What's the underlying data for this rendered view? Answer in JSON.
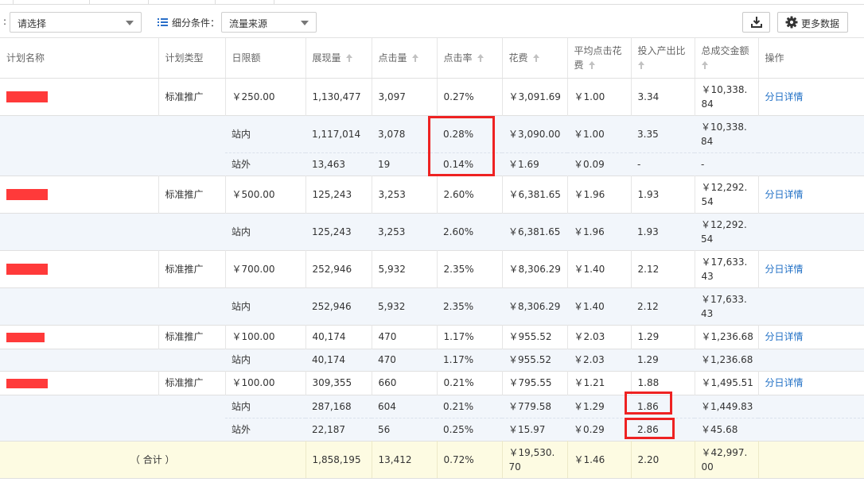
{
  "filter": {
    "colon": ":",
    "select_placeholder": "请选择",
    "segment_label": "细分条件：",
    "segment_value": "流量来源",
    "more_data_label": "更多数据"
  },
  "icons": {
    "list": "list-icon",
    "download": "download-icon",
    "settings": "gear-icon",
    "sort": "sort-up-arrow-icon",
    "dropdown": "chevron-down-icon"
  },
  "columns": {
    "plan_name": "计划名称",
    "plan_type": "计划类型",
    "daily_limit": "日限额",
    "impressions": "展现量",
    "clicks": "点击量",
    "ctr": "点击率",
    "cost": "花费",
    "avg_cpc": "平均点击花费",
    "roi": "投入产出比",
    "gmv": "总成交金额",
    "action": "操作"
  },
  "rows": {
    "p1": {
      "type": "标准推广",
      "limit": "￥250.00",
      "impr": "1,130,477",
      "clicks": "3,097",
      "ctr": "0.27%",
      "cost": "￥3,091.69",
      "cpc": "￥1.00",
      "roi": "3.34",
      "gmv": "￥10,338.84",
      "action": "分日详情"
    },
    "p1s1": {
      "source": "站内",
      "impr": "1,117,014",
      "clicks": "3,078",
      "ctr": "0.28%",
      "cost": "￥3,090.00",
      "cpc": "￥1.00",
      "roi": "3.35",
      "gmv": "￥10,338.84"
    },
    "p1s2": {
      "source": "站外",
      "impr": "13,463",
      "clicks": "19",
      "ctr": "0.14%",
      "cost": "￥1.69",
      "cpc": "￥0.09",
      "roi": "-",
      "gmv": "-"
    },
    "p2": {
      "type": "标准推广",
      "limit": "￥500.00",
      "impr": "125,243",
      "clicks": "3,253",
      "ctr": "2.60%",
      "cost": "￥6,381.65",
      "cpc": "￥1.96",
      "roi": "1.93",
      "gmv": "￥12,292.54",
      "action": "分日详情"
    },
    "p2s1": {
      "source": "站内",
      "impr": "125,243",
      "clicks": "3,253",
      "ctr": "2.60%",
      "cost": "￥6,381.65",
      "cpc": "￥1.96",
      "roi": "1.93",
      "gmv": "￥12,292.54"
    },
    "p3": {
      "type": "标准推广",
      "limit": "￥700.00",
      "impr": "252,946",
      "clicks": "5,932",
      "ctr": "2.35%",
      "cost": "￥8,306.29",
      "cpc": "￥1.40",
      "roi": "2.12",
      "gmv": "￥17,633.43",
      "action": "分日详情"
    },
    "p3s1": {
      "source": "站内",
      "impr": "252,946",
      "clicks": "5,932",
      "ctr": "2.35%",
      "cost": "￥8,306.29",
      "cpc": "￥1.40",
      "roi": "2.12",
      "gmv": "￥17,633.43"
    },
    "p4": {
      "type": "标准推广",
      "limit": "￥100.00",
      "impr": "40,174",
      "clicks": "470",
      "ctr": "1.17%",
      "cost": "￥955.52",
      "cpc": "￥2.03",
      "roi": "1.29",
      "gmv": "￥1,236.68",
      "action": "分日详情"
    },
    "p4s1": {
      "source": "站内",
      "impr": "40,174",
      "clicks": "470",
      "ctr": "1.17%",
      "cost": "￥955.52",
      "cpc": "￥2.03",
      "roi": "1.29",
      "gmv": "￥1,236.68"
    },
    "p5": {
      "type": "标准推广",
      "limit": "￥100.00",
      "impr": "309,355",
      "clicks": "660",
      "ctr": "0.21%",
      "cost": "￥795.55",
      "cpc": "￥1.21",
      "roi": "1.88",
      "gmv": "￥1,495.51",
      "action": "分日详情"
    },
    "p5s1": {
      "source": "站内",
      "impr": "287,168",
      "clicks": "604",
      "ctr": "0.21%",
      "cost": "￥779.58",
      "cpc": "￥1.29",
      "roi": "1.86",
      "gmv": "￥1,449.83"
    },
    "p5s2": {
      "source": "站外",
      "impr": "22,187",
      "clicks": "56",
      "ctr": "0.25%",
      "cost": "￥15.97",
      "cpc": "￥0.29",
      "roi": "2.86",
      "gmv": "￥45.68"
    }
  },
  "total": {
    "label": "（ 合计 ）",
    "impr": "1,858,195",
    "clicks": "13,412",
    "ctr": "0.72%",
    "cost": "￥19,530.70",
    "cpc": "￥1.46",
    "roi": "2.20",
    "gmv": "￥42,997.00"
  },
  "highlight_color": "#ee2222",
  "redaction_color": "#ff3a3a",
  "link_color": "#1f6fc5"
}
